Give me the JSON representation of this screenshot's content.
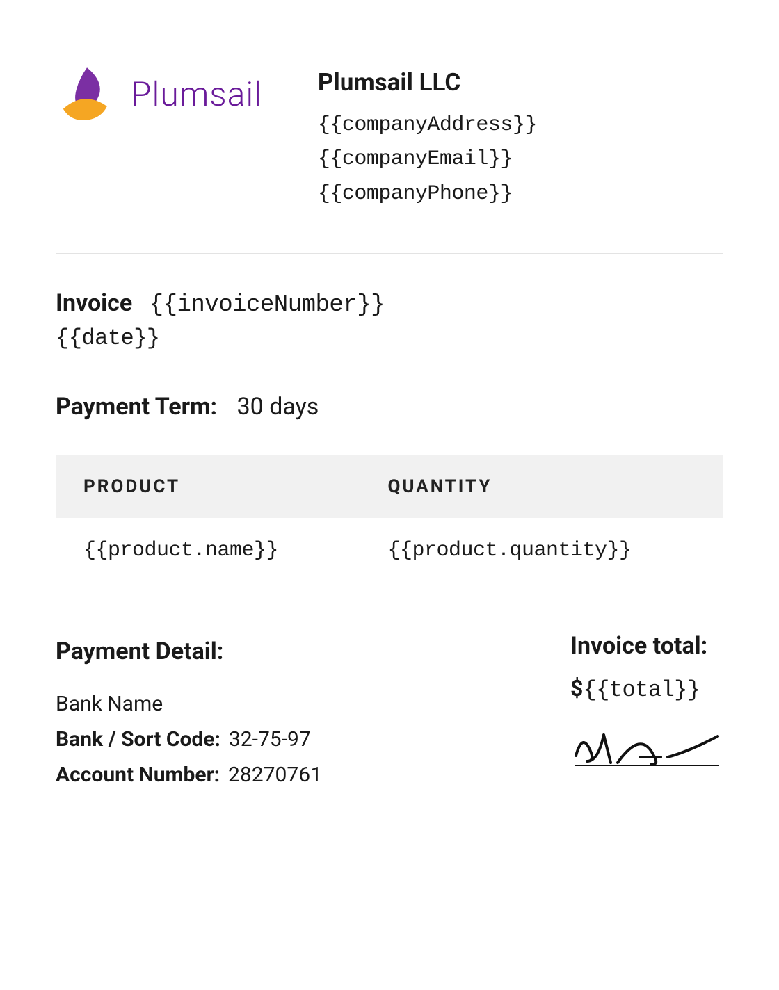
{
  "logo": {
    "text": "Plumsail"
  },
  "company": {
    "name": "Plumsail LLC",
    "address": "{{companyAddress}}",
    "email": "{{companyEmail}}",
    "phone": "{{companyPhone}}"
  },
  "invoice": {
    "label": "Invoice",
    "number": "{{invoiceNumber}}",
    "date": "{{date}}"
  },
  "paymentTerm": {
    "label": "Payment Term:",
    "value": "30 days"
  },
  "table": {
    "headers": {
      "product": "PRODUCT",
      "quantity": "QUANTITY"
    },
    "rows": [
      {
        "product": "{{product.name}}",
        "quantity": "{{product.quantity}}"
      }
    ]
  },
  "payment": {
    "heading": "Payment Detail:",
    "bankName": "Bank Name",
    "sortCodeLabel": "Bank / Sort Code:",
    "sortCode": "32-75-97",
    "accountLabel": "Account Number:",
    "account": "28270761"
  },
  "total": {
    "heading": "Invoice total:",
    "currency": "$",
    "amount": "{{total}}"
  }
}
